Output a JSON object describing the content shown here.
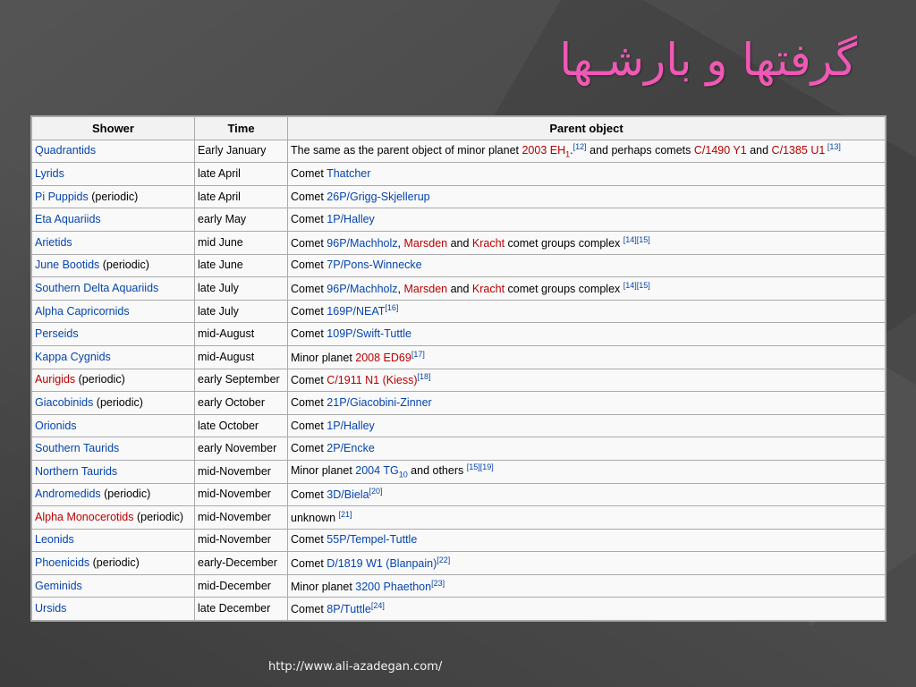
{
  "title": "گرفتها و بارشـها",
  "footer_url": "http://www.ali-azadegan.com/",
  "table": {
    "headers": [
      "Shower",
      "Time",
      "Parent object"
    ],
    "rows": [
      {
        "shower": [
          {
            "t": "Quadrantids",
            "c": "blue"
          }
        ],
        "time": "Early January",
        "parent": [
          {
            "t": "The same as the parent object of minor planet "
          },
          {
            "t": "2003 EH",
            "c": "red"
          },
          {
            "t": "1",
            "c": "red",
            "sub": true
          },
          {
            "t": "."
          },
          {
            "t": "[12]",
            "c": "ref"
          },
          {
            "t": " and perhaps comets "
          },
          {
            "t": "C/1490 Y1",
            "c": "red"
          },
          {
            "t": " and "
          },
          {
            "t": "C/1385 U1",
            "c": "red"
          },
          {
            "t": " [13]",
            "c": "ref"
          }
        ]
      },
      {
        "shower": [
          {
            "t": "Lyrids",
            "c": "blue"
          }
        ],
        "time": "late April",
        "parent": [
          {
            "t": "Comet "
          },
          {
            "t": "Thatcher",
            "c": "blue"
          }
        ]
      },
      {
        "shower": [
          {
            "t": "Pi Puppids",
            "c": "blue"
          },
          {
            "t": " (periodic)"
          }
        ],
        "time": "late April",
        "parent": [
          {
            "t": "Comet "
          },
          {
            "t": "26P/Grigg-Skjellerup",
            "c": "blue"
          }
        ]
      },
      {
        "shower": [
          {
            "t": "Eta Aquariids",
            "c": "blue"
          }
        ],
        "time": "early May",
        "parent": [
          {
            "t": "Comet "
          },
          {
            "t": "1P/Halley",
            "c": "blue"
          }
        ]
      },
      {
        "shower": [
          {
            "t": "Arietids",
            "c": "blue"
          }
        ],
        "time": "mid June",
        "parent": [
          {
            "t": "Comet "
          },
          {
            "t": "96P/Machholz",
            "c": "blue"
          },
          {
            "t": ", "
          },
          {
            "t": "Marsden",
            "c": "red"
          },
          {
            "t": " and "
          },
          {
            "t": "Kracht",
            "c": "red"
          },
          {
            "t": " comet groups complex "
          },
          {
            "t": "[14][15]",
            "c": "ref"
          }
        ]
      },
      {
        "shower": [
          {
            "t": "June Bootids",
            "c": "blue"
          },
          {
            "t": " (periodic)"
          }
        ],
        "time": "late June",
        "parent": [
          {
            "t": "Comet "
          },
          {
            "t": "7P/Pons-Winnecke",
            "c": "blue"
          }
        ]
      },
      {
        "shower": [
          {
            "t": "Southern Delta Aquariids",
            "c": "blue"
          }
        ],
        "time": "late July",
        "parent": [
          {
            "t": "Comet "
          },
          {
            "t": "96P/Machholz",
            "c": "blue"
          },
          {
            "t": ", "
          },
          {
            "t": "Marsden",
            "c": "red"
          },
          {
            "t": " and "
          },
          {
            "t": "Kracht",
            "c": "red"
          },
          {
            "t": " comet groups complex "
          },
          {
            "t": "[14][15]",
            "c": "ref"
          }
        ]
      },
      {
        "shower": [
          {
            "t": "Alpha Capricornids",
            "c": "blue"
          }
        ],
        "time": "late July",
        "parent": [
          {
            "t": "Comet "
          },
          {
            "t": "169P/NEAT",
            "c": "blue"
          },
          {
            "t": "[16]",
            "c": "ref"
          }
        ]
      },
      {
        "shower": [
          {
            "t": "Perseids",
            "c": "blue"
          }
        ],
        "time": "mid-August",
        "parent": [
          {
            "t": "Comet "
          },
          {
            "t": "109P/Swift-Tuttle",
            "c": "blue"
          }
        ]
      },
      {
        "shower": [
          {
            "t": "Kappa Cygnids",
            "c": "blue"
          }
        ],
        "time": "mid-August",
        "parent": [
          {
            "t": "Minor planet "
          },
          {
            "t": "2008 ED69",
            "c": "red"
          },
          {
            "t": "[17]",
            "c": "ref"
          }
        ]
      },
      {
        "shower": [
          {
            "t": "Aurigids",
            "c": "red"
          },
          {
            "t": " (periodic)"
          }
        ],
        "time": "early September",
        "parent": [
          {
            "t": "Comet "
          },
          {
            "t": "C/1911 N1 (Kiess)",
            "c": "red"
          },
          {
            "t": "[18]",
            "c": "ref"
          }
        ]
      },
      {
        "shower": [
          {
            "t": "Giacobinids",
            "c": "blue"
          },
          {
            "t": " (periodic)"
          }
        ],
        "time": "early October",
        "parent": [
          {
            "t": "Comet "
          },
          {
            "t": "21P/Giacobini-Zinner",
            "c": "blue"
          }
        ]
      },
      {
        "shower": [
          {
            "t": "Orionids",
            "c": "blue"
          }
        ],
        "time": "late October",
        "parent": [
          {
            "t": "Comet "
          },
          {
            "t": "1P/Halley",
            "c": "blue"
          }
        ]
      },
      {
        "shower": [
          {
            "t": "Southern Taurids",
            "c": "blue"
          }
        ],
        "time": "early November",
        "parent": [
          {
            "t": "Comet "
          },
          {
            "t": "2P/Encke",
            "c": "blue"
          }
        ]
      },
      {
        "shower": [
          {
            "t": "Northern Taurids",
            "c": "blue"
          }
        ],
        "time": "mid-November",
        "parent": [
          {
            "t": "Minor planet "
          },
          {
            "t": "2004 TG",
            "c": "blue"
          },
          {
            "t": "10",
            "c": "blue",
            "sub": true
          },
          {
            "t": " and others "
          },
          {
            "t": "[15][19]",
            "c": "ref"
          }
        ]
      },
      {
        "shower": [
          {
            "t": "Andromedids",
            "c": "blue"
          },
          {
            "t": " (periodic)"
          }
        ],
        "time": "mid-November",
        "parent": [
          {
            "t": "Comet "
          },
          {
            "t": "3D/Biela",
            "c": "blue"
          },
          {
            "t": "[20]",
            "c": "ref"
          }
        ]
      },
      {
        "shower": [
          {
            "t": "Alpha Monocerotids",
            "c": "red"
          },
          {
            "t": " (periodic)"
          }
        ],
        "time": "mid-November",
        "parent": [
          {
            "t": "unknown "
          },
          {
            "t": "[21]",
            "c": "ref"
          }
        ]
      },
      {
        "shower": [
          {
            "t": "Leonids",
            "c": "blue"
          }
        ],
        "time": "mid-November",
        "parent": [
          {
            "t": "Comet "
          },
          {
            "t": "55P/Tempel-Tuttle",
            "c": "blue"
          }
        ]
      },
      {
        "shower": [
          {
            "t": "Phoenicids",
            "c": "blue"
          },
          {
            "t": " (periodic)"
          }
        ],
        "time": "early-December",
        "parent": [
          {
            "t": "Comet "
          },
          {
            "t": "D/1819 W1 (Blanpain)",
            "c": "blue"
          },
          {
            "t": "[22]",
            "c": "ref"
          }
        ]
      },
      {
        "shower": [
          {
            "t": "Geminids",
            "c": "blue"
          }
        ],
        "time": "mid-December",
        "parent": [
          {
            "t": "Minor planet "
          },
          {
            "t": "3200 Phaethon",
            "c": "blue"
          },
          {
            "t": "[23]",
            "c": "ref"
          }
        ]
      },
      {
        "shower": [
          {
            "t": "Ursids",
            "c": "blue"
          }
        ],
        "time": "late December",
        "parent": [
          {
            "t": "Comet "
          },
          {
            "t": "8P/Tuttle",
            "c": "blue"
          },
          {
            "t": "[24]",
            "c": "ref"
          }
        ]
      }
    ]
  },
  "colors": {
    "background": "#4a4a4a",
    "title": "#f058b5",
    "link_blue": "#0645ad",
    "link_red": "#ba0000"
  }
}
